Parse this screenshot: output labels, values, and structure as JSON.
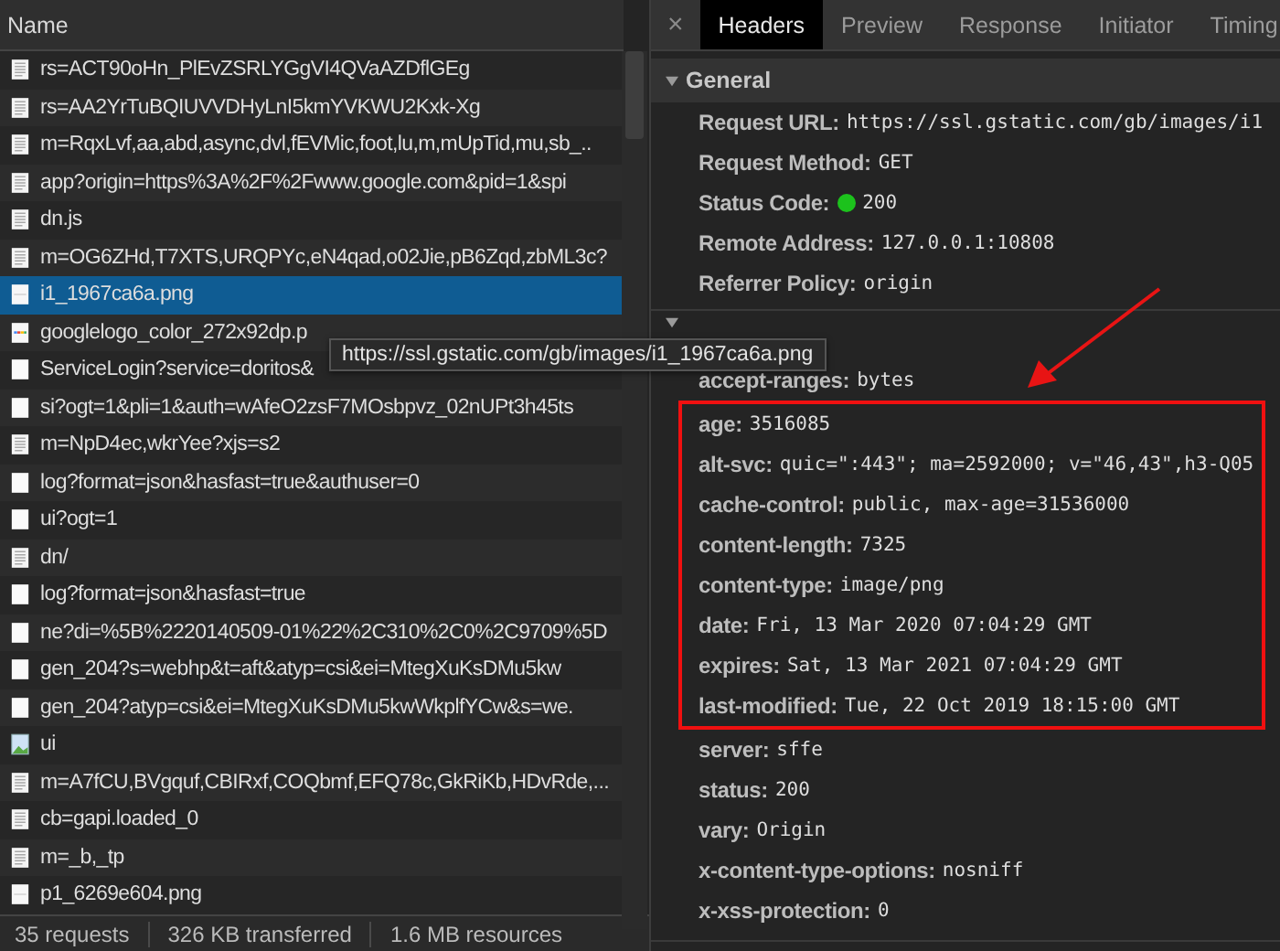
{
  "requests": {
    "column": "Name",
    "rows": [
      {
        "name": "rs=ACT90oHn_PlEvZSRLYGgVI4QVaAZDflGEg",
        "kind": "doc",
        "selected": false
      },
      {
        "name": "rs=AA2YrTuBQIUVVDHyLnI5kmYVKWU2Kxk-Xg",
        "kind": "doc",
        "selected": false
      },
      {
        "name": "m=RqxLvf,aa,abd,async,dvl,fEVMic,foot,lu,m,mUpTid,mu,sb_..",
        "kind": "doc",
        "selected": false
      },
      {
        "name": "app?origin=https%3A%2F%2Fwww.google.com&pid=1&spi",
        "kind": "doc",
        "selected": false
      },
      {
        "name": "dn.js",
        "kind": "doc",
        "selected": false
      },
      {
        "name": "m=OG6ZHd,T7XTS,URQPYc,eN4qad,o02Jie,pB6Zqd,zbML3c?",
        "kind": "doc",
        "selected": false
      },
      {
        "name": "i1_1967ca6a.png",
        "kind": "image",
        "selected": true
      },
      {
        "name": "googlelogo_color_272x92dp.p",
        "kind": "logo",
        "selected": false
      },
      {
        "name": "ServiceLogin?service=doritos&",
        "kind": "blank",
        "selected": false
      },
      {
        "name": "si?ogt=1&pli=1&auth=wAfeO2zsF7MOsbpvz_02nUPt3h45ts",
        "kind": "blank",
        "selected": false
      },
      {
        "name": "m=NpD4ec,wkrYee?xjs=s2",
        "kind": "doc",
        "selected": false
      },
      {
        "name": "log?format=json&hasfast=true&authuser=0",
        "kind": "blank",
        "selected": false
      },
      {
        "name": "ui?ogt=1",
        "kind": "blank",
        "selected": false
      },
      {
        "name": "dn/",
        "kind": "doc",
        "selected": false
      },
      {
        "name": "log?format=json&hasfast=true",
        "kind": "blank",
        "selected": false
      },
      {
        "name": "ne?di=%5B%2220140509-01%22%2C310%2C0%2C9709%5D",
        "kind": "blank",
        "selected": false
      },
      {
        "name": "gen_204?s=webhp&t=aft&atyp=csi&ei=MtegXuKsDMu5kw",
        "kind": "blank",
        "selected": false
      },
      {
        "name": "gen_204?atyp=csi&ei=MtegXuKsDMu5kwWkplfYCw&s=we.",
        "kind": "blank",
        "selected": false
      },
      {
        "name": "ui",
        "kind": "photo",
        "selected": false
      },
      {
        "name": "m=A7fCU,BVgquf,CBIRxf,COQbmf,EFQ78c,GkRiKb,HDvRde,...",
        "kind": "doc",
        "selected": false
      },
      {
        "name": "cb=gapi.loaded_0",
        "kind": "doc",
        "selected": false
      },
      {
        "name": "m=_b,_tp",
        "kind": "doc",
        "selected": false
      },
      {
        "name": "p1_6269e604.png",
        "kind": "image",
        "selected": false
      }
    ],
    "tooltip": "https://ssl.gstatic.com/gb/images/i1_1967ca6a.png",
    "status_bar": [
      "35 requests",
      "326 KB transferred",
      "1.6 MB resources"
    ]
  },
  "details": {
    "close": "×",
    "tabs": [
      {
        "label": "Headers",
        "selected": true
      },
      {
        "label": "Preview",
        "selected": false
      },
      {
        "label": "Response",
        "selected": false
      },
      {
        "label": "Initiator",
        "selected": false
      },
      {
        "label": "Timing",
        "selected": false
      }
    ],
    "general": {
      "title": "General",
      "expanded": true,
      "rows": [
        {
          "key": "Request URL:",
          "value": "https://ssl.gstatic.com/gb/images/i1",
          "status_dot": false
        },
        {
          "key": "Request Method:",
          "value": "GET",
          "status_dot": false
        },
        {
          "key": "Status Code:",
          "value": "200",
          "status_dot": true
        },
        {
          "key": "Remote Address:",
          "value": "127.0.0.1:10808",
          "status_dot": false
        },
        {
          "key": "Referrer Policy:",
          "value": "origin",
          "status_dot": false
        }
      ]
    },
    "response_headers": {
      "expanded": true,
      "rows": [
        {
          "key": "accept-ranges:",
          "value": "bytes",
          "highlighted": false
        },
        {
          "key": "age:",
          "value": "3516085",
          "highlighted": true
        },
        {
          "key": "alt-svc:",
          "value": "quic=\":443\"; ma=2592000; v=\"46,43\",h3-Q05",
          "highlighted": true
        },
        {
          "key": "cache-control:",
          "value": "public, max-age=31536000",
          "highlighted": true
        },
        {
          "key": "content-length:",
          "value": "7325",
          "highlighted": true
        },
        {
          "key": "content-type:",
          "value": "image/png",
          "highlighted": true
        },
        {
          "key": "date:",
          "value": "Fri, 13 Mar 2020 07:04:29 GMT",
          "highlighted": true
        },
        {
          "key": "expires:",
          "value": "Sat, 13 Mar 2021 07:04:29 GMT",
          "highlighted": true
        },
        {
          "key": "last-modified:",
          "value": "Tue, 22 Oct 2019 18:15:00 GMT",
          "highlighted": true
        },
        {
          "key": "server:",
          "value": "sffe",
          "highlighted": false
        },
        {
          "key": "status:",
          "value": "200",
          "highlighted": false
        },
        {
          "key": "vary:",
          "value": "Origin",
          "highlighted": false
        },
        {
          "key": "x-content-type-options:",
          "value": "nosniff",
          "highlighted": false
        },
        {
          "key": "x-xss-protection:",
          "value": "0",
          "highlighted": false
        }
      ]
    }
  }
}
